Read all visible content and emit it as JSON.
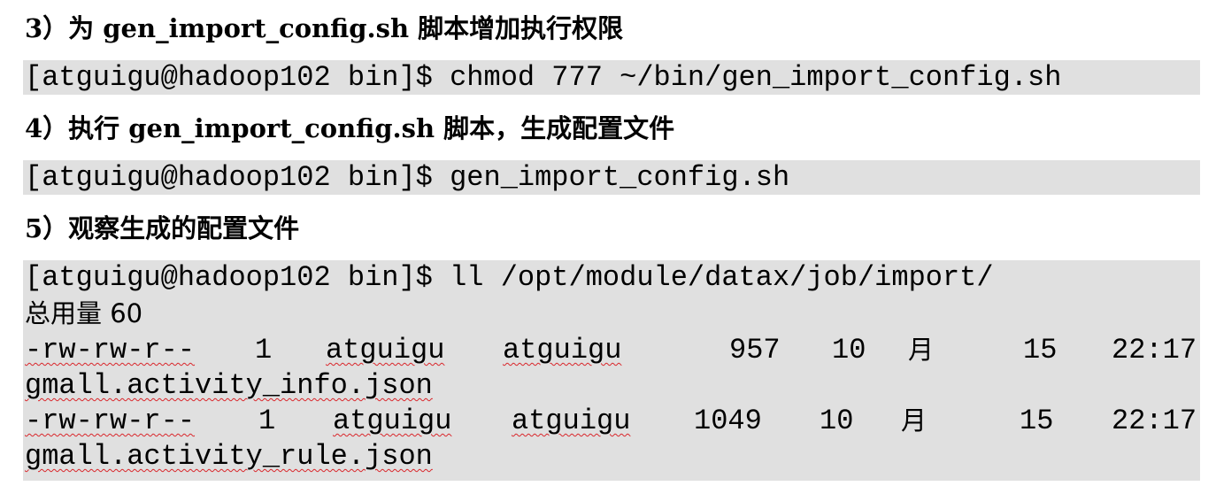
{
  "steps": [
    {
      "heading": "3）为 gen_import_config.sh 脚本增加执行权限",
      "commands": [
        "[atguigu@hadoop102 bin]$ chmod 777 ~/bin/gen_import_config.sh"
      ]
    },
    {
      "heading": "4）执行 gen_import_config.sh 脚本，生成配置文件",
      "commands": [
        "[atguigu@hadoop102 bin]$ gen_import_config.sh"
      ]
    },
    {
      "heading": "5）观察生成的配置文件",
      "command": "[atguigu@hadoop102 bin]$ ll /opt/module/datax/job/import/",
      "total_line": "总用量 60",
      "files": [
        {
          "perms": "-rw-rw-r--",
          "links": "1",
          "owner": "atguigu",
          "group": "atguigu",
          "size": "957",
          "month_num": "10",
          "month_unit": "月",
          "day": "15",
          "time": "22:17",
          "name": "gmall.activity_info.json"
        },
        {
          "perms": "-rw-rw-r--",
          "links": "1",
          "owner": "atguigu",
          "group": "atguigu",
          "size": "1049",
          "month_num": "10",
          "month_unit": "月",
          "day": "15",
          "time": "22:17",
          "name": "gmall.activity_rule.json"
        }
      ]
    }
  ],
  "colors": {
    "code_background": "#e0e0e0",
    "spellcheck_underline": "#d9252a"
  }
}
